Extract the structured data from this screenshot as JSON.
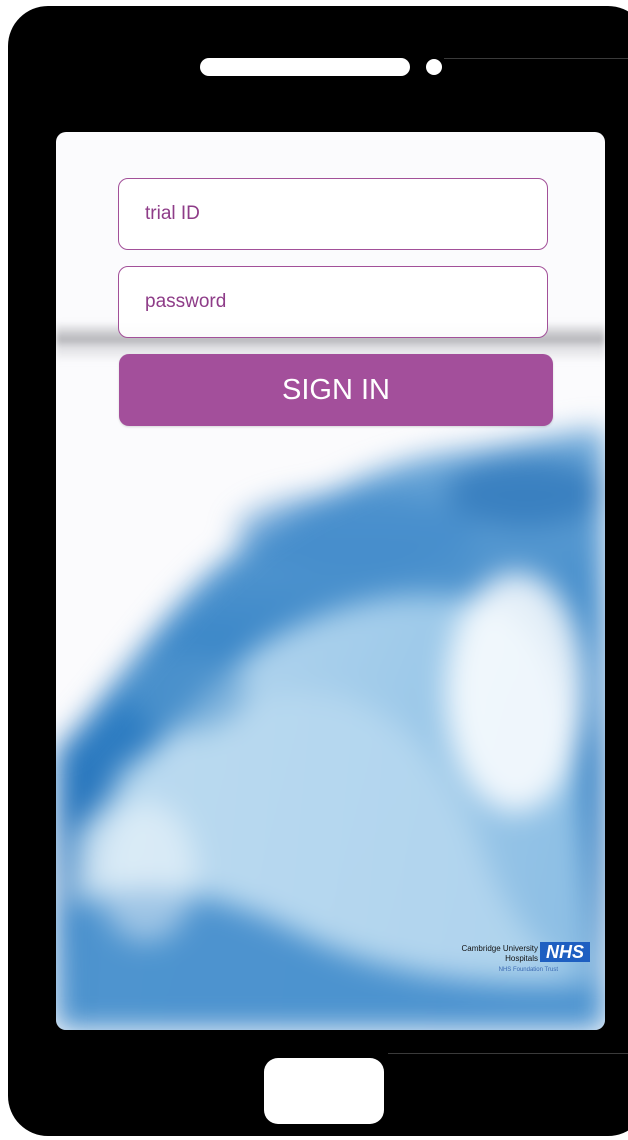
{
  "login": {
    "trial_id_placeholder": "trial ID",
    "password_placeholder": "password",
    "sign_in_label": "SIGN IN"
  },
  "logo": {
    "org_line1": "Cambridge University",
    "org_line2": "Hospitals",
    "nhs": "NHS",
    "trust": "NHS Foundation Trust"
  },
  "colors": {
    "accent": "#a34f9b",
    "field_border": "#a25099",
    "field_text": "#8e3c88",
    "nhs_blue": "#1e5fc1"
  }
}
